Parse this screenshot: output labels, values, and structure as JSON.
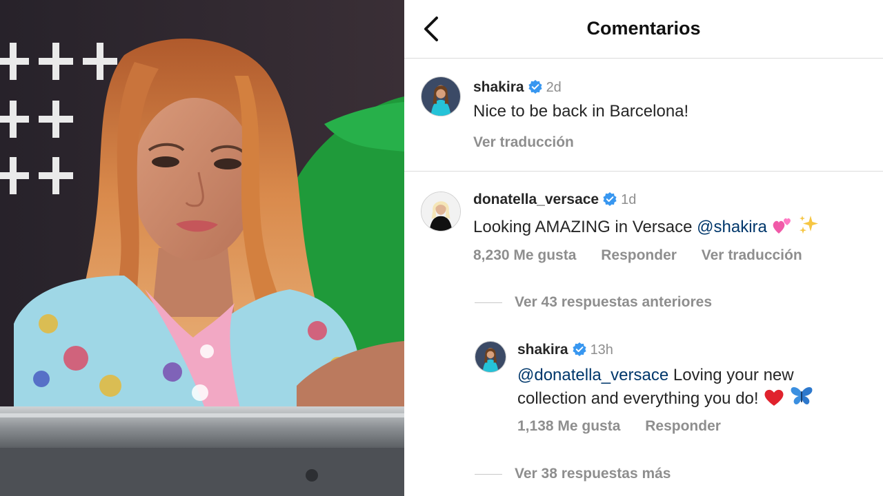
{
  "header": {
    "title": "Comentarios",
    "back_icon": "chevron-left-icon"
  },
  "caption": {
    "username": "shakira",
    "time": "2d",
    "text": "Nice to be back in Barcelona!",
    "translate": "Ver traducción"
  },
  "comment": {
    "username": "donatella_versace",
    "time": "1d",
    "text": "Looking AMAZING in Versace ",
    "mention": "@shakira",
    "emojis": [
      "two-hearts-icon",
      "sparkles-icon"
    ],
    "likes": "8,230 Me gusta",
    "reply": "Responder",
    "translate": "Ver traducción",
    "view_previous": "Ver 43 respuestas anteriores"
  },
  "reply": {
    "username": "shakira",
    "time": "13h",
    "mention": "@donatella_versace",
    "text_line1": " Loving your new",
    "text_line2": "collection and everything you do!",
    "emojis": [
      "red-heart-icon",
      "butterfly-icon"
    ],
    "likes": "1,138 Me gusta",
    "reply": "Responder",
    "view_more": "Ver 38 respuestas más"
  },
  "colors": {
    "verified": "#3897f0",
    "muted": "#8e8e8e",
    "mention": "#00376b",
    "divider": "#dbdbdb"
  }
}
